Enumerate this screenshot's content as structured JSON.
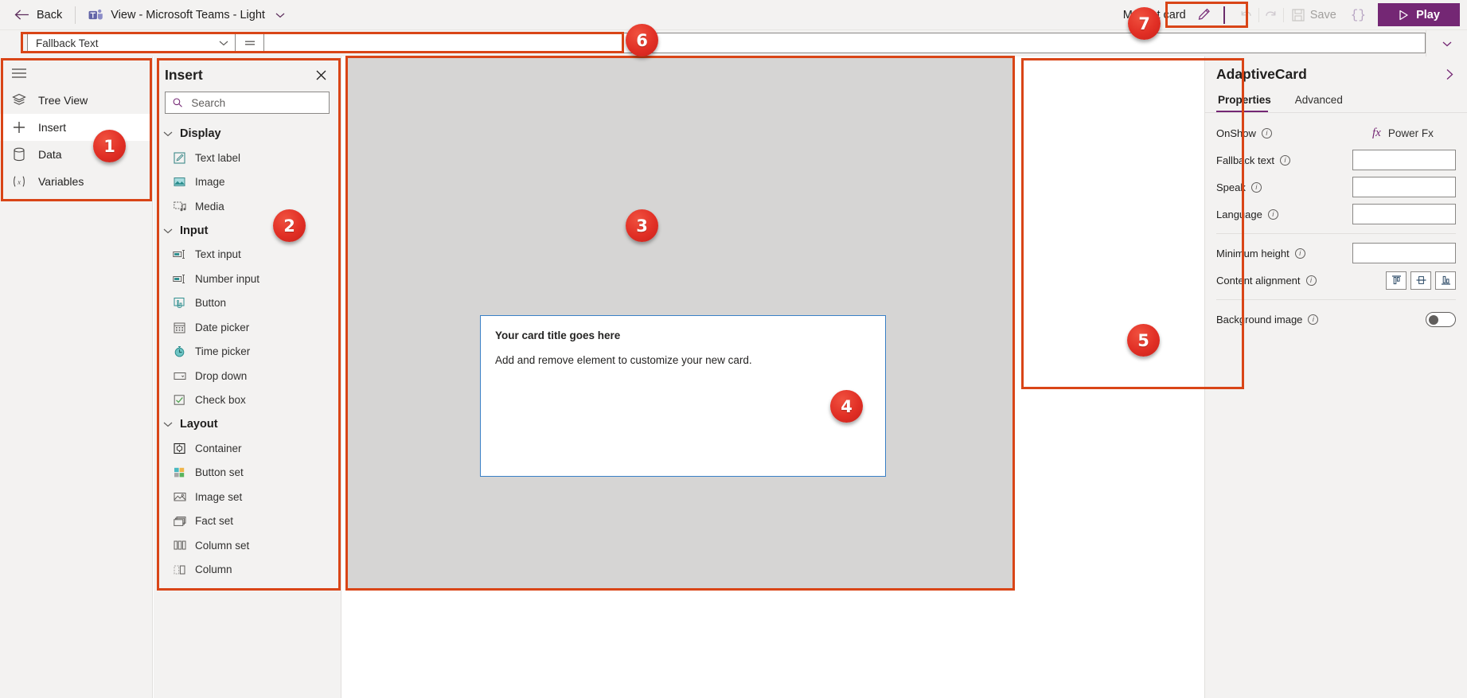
{
  "topbar": {
    "back_label": "Back",
    "app_switcher_label": "View - Microsoft Teams - Light",
    "card_name": "My first card",
    "rename_icon": "pencil-icon",
    "undo_icon": "undo-arrow-icon",
    "redo_icon": "redo-arrow-icon",
    "save_label": "Save",
    "save_icon": "floppy-disk-icon",
    "json_label": "{}",
    "play_label": "Play",
    "play_icon": "play-triangle-icon"
  },
  "formula_bar": {
    "property": "Fallback Text",
    "equals_icon": "equals-icon",
    "formula_value": "",
    "expand_icon": "chevron-down-icon"
  },
  "rail": {
    "menu_icon": "hamburger-icon",
    "items": [
      {
        "label": "Tree View",
        "icon": "layers-icon",
        "active": false
      },
      {
        "label": "Insert",
        "icon": "plus-icon",
        "active": true
      },
      {
        "label": "Data",
        "icon": "database-icon",
        "active": false
      },
      {
        "label": "Variables",
        "icon": "variables-icon",
        "active": false
      }
    ]
  },
  "insert_panel": {
    "title": "Insert",
    "close_icon": "close-icon",
    "search_placeholder": "Search",
    "search_value": "",
    "search_icon": "search-icon",
    "groups": [
      {
        "name": "Display",
        "expanded": true,
        "items": [
          {
            "label": "Text label",
            "icon": "text-label-icon"
          },
          {
            "label": "Image",
            "icon": "image-icon"
          },
          {
            "label": "Media",
            "icon": "media-icon"
          }
        ]
      },
      {
        "name": "Input",
        "expanded": true,
        "items": [
          {
            "label": "Text input",
            "icon": "text-input-icon"
          },
          {
            "label": "Number input",
            "icon": "number-input-icon"
          },
          {
            "label": "Button",
            "icon": "button-icon"
          },
          {
            "label": "Date picker",
            "icon": "calendar-icon"
          },
          {
            "label": "Time picker",
            "icon": "clock-icon"
          },
          {
            "label": "Drop down",
            "icon": "dropdown-icon"
          },
          {
            "label": "Check box",
            "icon": "checkbox-icon"
          }
        ]
      },
      {
        "name": "Layout",
        "expanded": true,
        "items": [
          {
            "label": "Container",
            "icon": "container-icon"
          },
          {
            "label": "Button set",
            "icon": "button-set-icon"
          },
          {
            "label": "Image set",
            "icon": "image-set-icon"
          },
          {
            "label": "Fact set",
            "icon": "fact-set-icon"
          },
          {
            "label": "Column set",
            "icon": "column-set-icon"
          },
          {
            "label": "Column",
            "icon": "column-icon"
          }
        ]
      }
    ]
  },
  "canvas": {
    "card": {
      "title": "Your card title goes here",
      "body": "Add and remove element to customize your new card."
    }
  },
  "properties_panel": {
    "title": "AdaptiveCard",
    "collapse_icon": "chevron-right-icon",
    "tabs": [
      {
        "label": "Properties",
        "active": true
      },
      {
        "label": "Advanced",
        "active": false
      }
    ],
    "rows": {
      "onshow": {
        "label": "OnShow",
        "action_label": "Power Fx",
        "action_icon": "fx-icon"
      },
      "fallback_text": {
        "label": "Fallback text",
        "value": ""
      },
      "speak": {
        "label": "Speak",
        "value": ""
      },
      "language": {
        "label": "Language",
        "value": ""
      },
      "minimum_height": {
        "label": "Minimum height",
        "value": ""
      },
      "content_alignment": {
        "label": "Content alignment",
        "options": [
          "align-top-icon",
          "align-middle-icon",
          "align-bottom-icon"
        ],
        "selected": null
      },
      "background_image": {
        "label": "Background image",
        "enabled": false
      }
    }
  },
  "annotations": {
    "markers": [
      {
        "number": "1",
        "target": "left-rail"
      },
      {
        "number": "2",
        "target": "insert-panel"
      },
      {
        "number": "3",
        "target": "canvas"
      },
      {
        "number": "4",
        "target": "adaptive-card"
      },
      {
        "number": "5",
        "target": "properties-panel"
      },
      {
        "number": "6",
        "target": "formula-bar"
      },
      {
        "number": "7",
        "target": "play-button"
      }
    ]
  },
  "colors": {
    "accent_purple": "#742774",
    "annotation_orange": "#d94517",
    "badge_red": "#e12f25",
    "canvas_gray": "#d6d5d4",
    "chrome_gray": "#f3f2f1",
    "card_border_blue": "#3a80c6"
  }
}
